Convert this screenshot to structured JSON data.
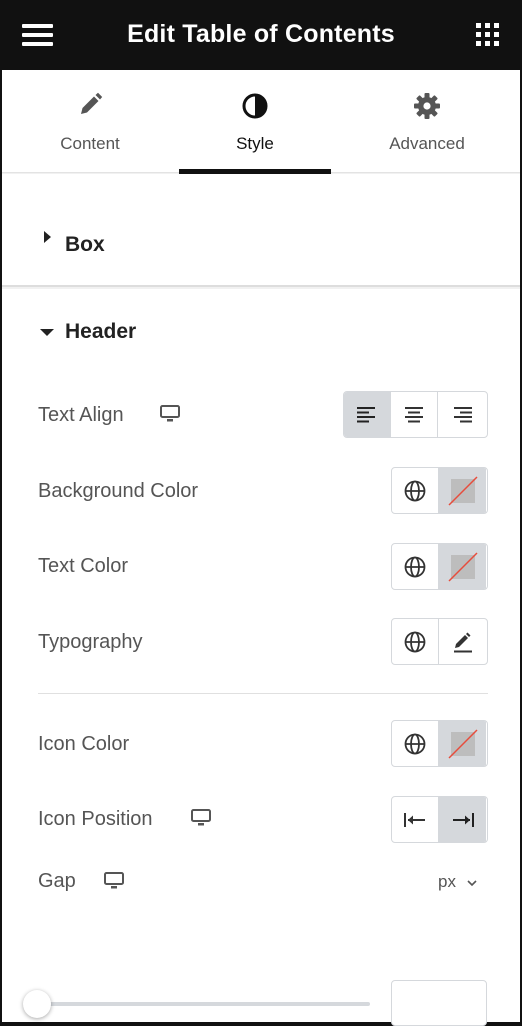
{
  "header": {
    "title": "Edit Table of Contents",
    "menu_icon": "hamburger-icon",
    "apps_icon": "grid-icon"
  },
  "tabs": [
    {
      "label": "Content",
      "icon": "pencil-icon",
      "active": false
    },
    {
      "label": "Style",
      "icon": "contrast-icon",
      "active": true
    },
    {
      "label": "Advanced",
      "icon": "gear-icon",
      "active": false
    }
  ],
  "sections": {
    "box": {
      "title": "Box",
      "expanded": false
    },
    "header": {
      "title": "Header",
      "expanded": true
    }
  },
  "controls": {
    "text_align": {
      "label": "Text Align",
      "options": [
        "left",
        "center",
        "right"
      ],
      "selected": "left"
    },
    "background_color": {
      "label": "Background Color"
    },
    "text_color": {
      "label": "Text Color"
    },
    "typography": {
      "label": "Typography"
    },
    "icon_color": {
      "label": "Icon Color"
    },
    "icon_position": {
      "label": "Icon Position",
      "options": [
        "before",
        "after"
      ],
      "selected": "after"
    },
    "gap": {
      "label": "Gap",
      "unit": "px",
      "value": "",
      "slider_fraction": 0
    }
  },
  "colors": {
    "topbar": "#111111",
    "panel_bg": "#f1f1f1",
    "selected_button": "#d5d8dc",
    "no_color_slash": "#e74c3c"
  }
}
